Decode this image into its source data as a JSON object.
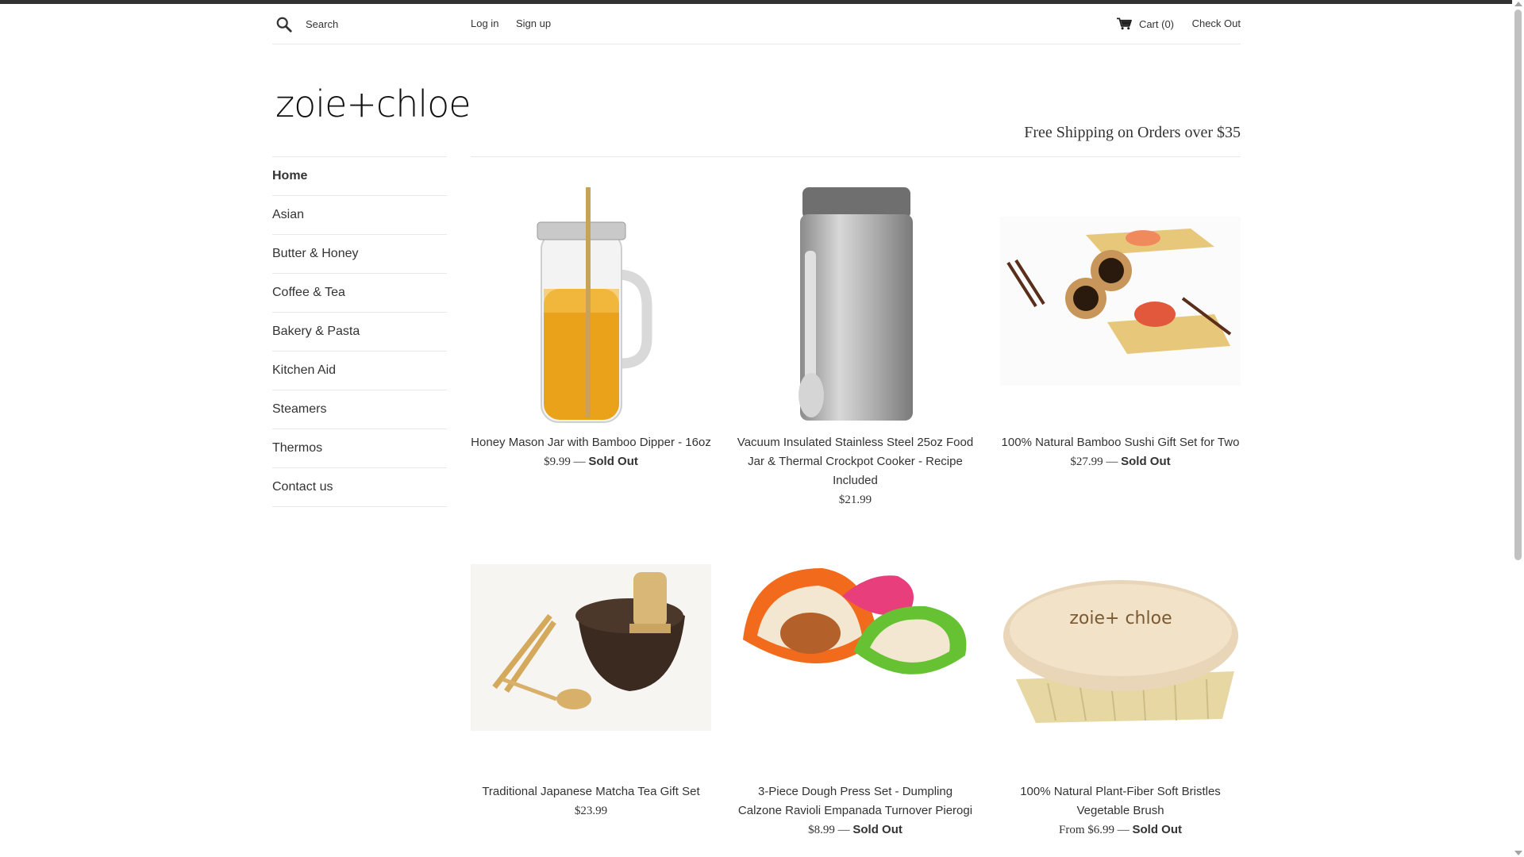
{
  "header": {
    "search_placeholder": "Search",
    "login": "Log in",
    "signup": "Sign up",
    "cart": "Cart (0)",
    "checkout": "Check Out"
  },
  "brand": {
    "logo": "zoie+chloe",
    "shipping": "Free Shipping on Orders over $35"
  },
  "nav": [
    {
      "label": "Home",
      "active": true
    },
    {
      "label": "Asian"
    },
    {
      "label": "Butter & Honey"
    },
    {
      "label": "Coffee & Tea"
    },
    {
      "label": "Bakery & Pasta"
    },
    {
      "label": "Kitchen Aid"
    },
    {
      "label": "Steamers"
    },
    {
      "label": "Thermos"
    },
    {
      "label": "Contact us"
    }
  ],
  "products": [
    {
      "title": "Honey Mason Jar with Bamboo Dipper - 16oz",
      "price": "$9.99",
      "sep": " — ",
      "sold": "Sold Out",
      "image": "mason-jar"
    },
    {
      "title": "Vacuum Insulated Stainless Steel 25oz Food Jar & Thermal Crockpot Cooker - Recipe Included",
      "price": "$21.99",
      "image": "food-jar"
    },
    {
      "title": "100% Natural Bamboo Sushi Gift Set for Two",
      "price": "$27.99",
      "sep": " — ",
      "sold": "Sold Out",
      "image": "sushi-set"
    },
    {
      "title": "Traditional Japanese Matcha Tea Gift Set",
      "price": "$23.99",
      "image": "matcha-set"
    },
    {
      "title": "3-Piece Dough Press Set - Dumpling Calzone Ravioli Empanada Turnover Pierogi",
      "price": "$8.99",
      "sep": " — ",
      "sold": "Sold Out",
      "image": "dough-press"
    },
    {
      "title": "100% Natural Plant-Fiber Soft Bristles Vegetable Brush",
      "price": "From $6.99",
      "sep": " — ",
      "sold": "Sold Out",
      "image": "vegetable-brush",
      "brush_text": "zoie+ chloe"
    }
  ]
}
